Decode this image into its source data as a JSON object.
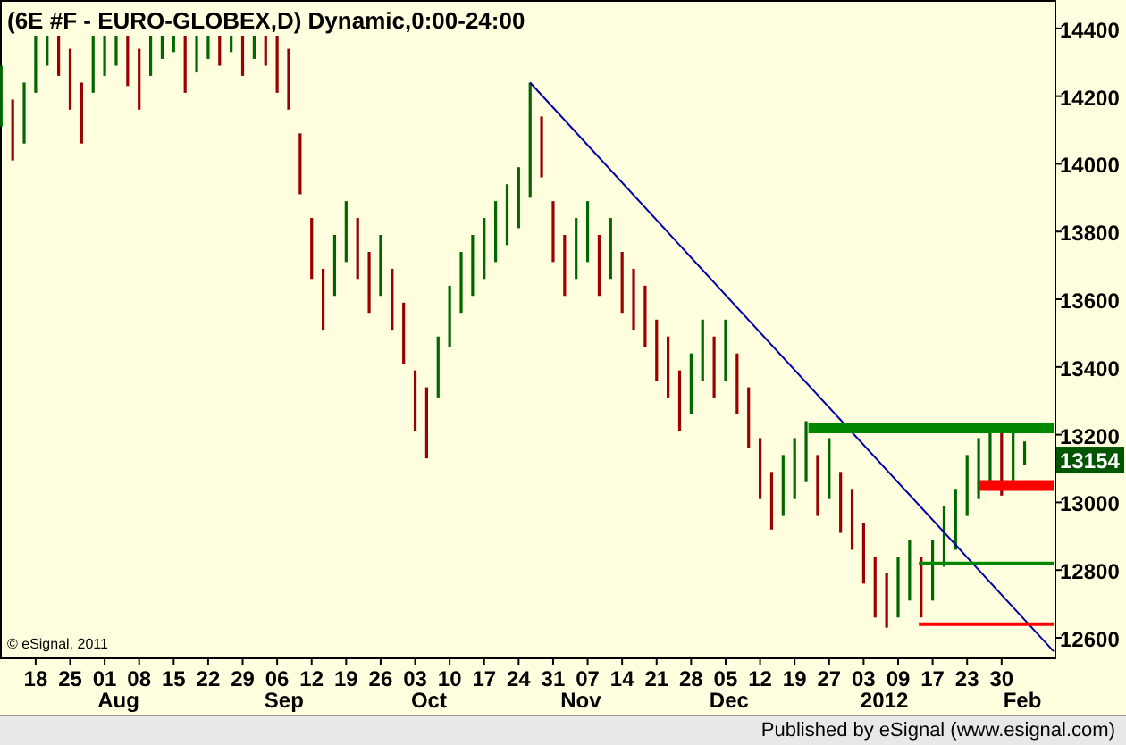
{
  "chart": {
    "title": "(6E #F - EURO-GLOBEX,D) Dynamic,0:00-24:00",
    "y_labels": [
      "14400",
      "14200",
      "14000",
      "13800",
      "13600",
      "13400",
      "13200",
      "13000",
      "12800",
      "12600"
    ],
    "x_labels": [
      "18",
      "25",
      "01",
      "08",
      "15",
      "22",
      "29",
      "06",
      "12",
      "19",
      "26",
      "03",
      "10",
      "17",
      "24",
      "31",
      "07",
      "14",
      "21",
      "28",
      "05",
      "12",
      "19",
      "27",
      "03",
      "09",
      "17",
      "23",
      "30"
    ],
    "month_labels": [
      "Aug",
      "Sep",
      "Oct",
      "Nov",
      "Dec",
      "2012",
      "Feb"
    ],
    "last_price": "13154",
    "copyright": "© eSignal, 2011"
  },
  "footer": {
    "text": "Published by eSignal (www.esignal.com)"
  }
}
